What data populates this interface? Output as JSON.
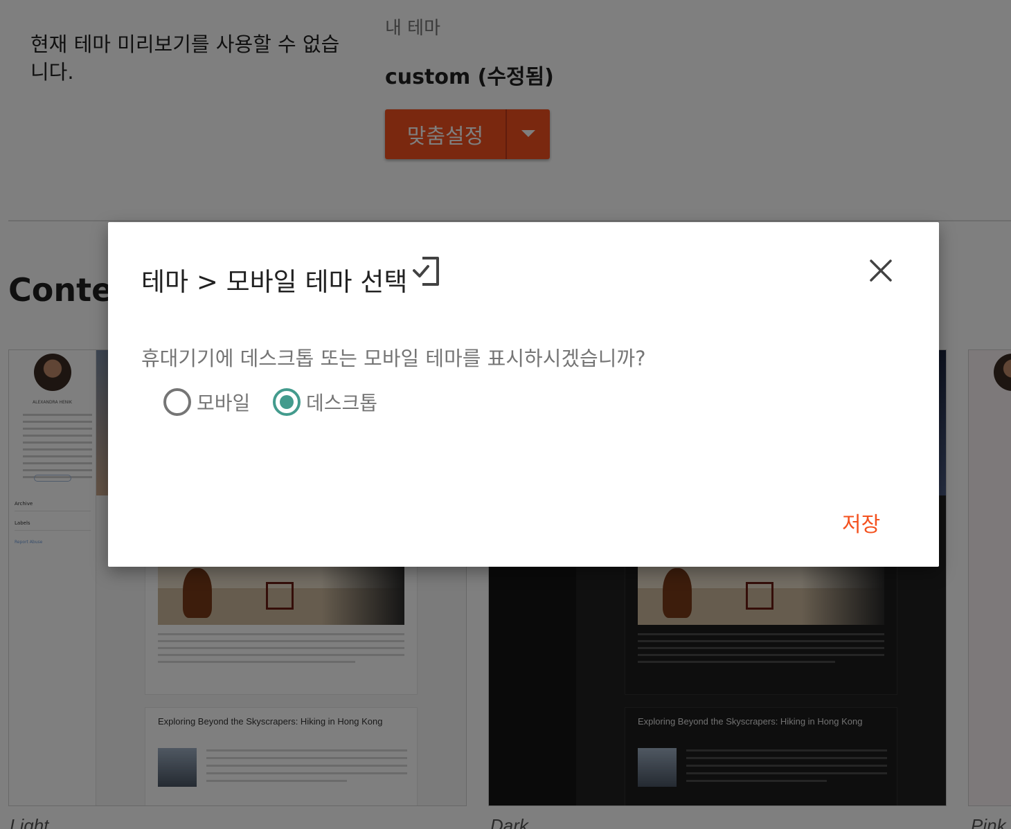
{
  "header": {
    "preview_unavailable": "현재 테마 미리보기를 사용할 수 없습니다.",
    "my_theme_label": "내 테마",
    "theme_name": "custom (수정됨)",
    "customize_label": "맞춤설정"
  },
  "section": {
    "title": "Conter"
  },
  "cards": [
    {
      "caption": "Light",
      "post_title": "Exploring Beyond the Skyscrapers: Hiking in Hong Kong",
      "side_name": "ALEXANDRA HENIK",
      "side_items": [
        "Archive",
        "Labels"
      ],
      "side_link": "Report Abuse"
    },
    {
      "caption": "Dark",
      "post_title": "Exploring Beyond the Skyscrapers: Hiking in Hong Kong"
    },
    {
      "caption": "Pink"
    }
  ],
  "dialog": {
    "title": "테마 > 모바일 테마 선택",
    "question": "휴대기기에 데스크톱 또는 모바일 테마를 표시하시겠습니까?",
    "options": [
      {
        "label": "모바일",
        "selected": false
      },
      {
        "label": "데스크톱",
        "selected": true
      }
    ],
    "save_label": "저장"
  },
  "colors": {
    "accent": "#f4511e",
    "radio_selected": "#439b8d",
    "scrim": "rgba(0,0,0,0.5)"
  },
  "icons": [
    "mobile-check-icon",
    "close-icon",
    "dropdown-arrow-icon"
  ]
}
